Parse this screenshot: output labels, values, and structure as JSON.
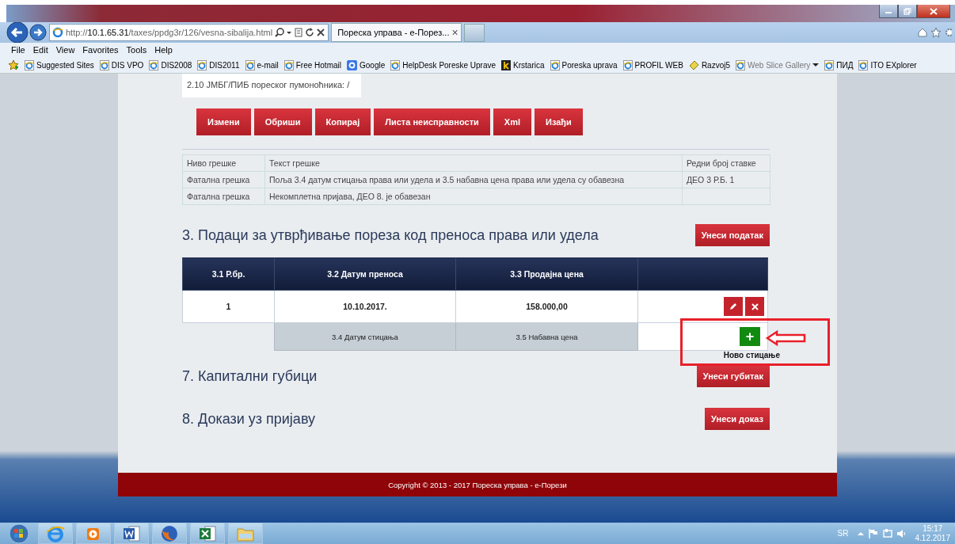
{
  "browser": {
    "address": "http://**10.1.65.31**/taxes/ppdg3r/126/vesna-sibalija.html",
    "tab": {
      "title": "Пореска управа - е-Порез...",
      "close": "×"
    },
    "menu": [
      "File",
      "Edit",
      "View",
      "Favorites",
      "Tools",
      "Help"
    ],
    "favorites": [
      {
        "label": "Suggested Sites",
        "kind": "ie"
      },
      {
        "label": "DIS VPO",
        "kind": "ie"
      },
      {
        "label": "DIS2008",
        "kind": "ie"
      },
      {
        "label": "DIS2011",
        "kind": "ie"
      },
      {
        "label": "e-mail",
        "kind": "ie"
      },
      {
        "label": "Free Hotmail",
        "kind": "ie"
      },
      {
        "label": "Google",
        "kind": "google"
      },
      {
        "label": "HelpDesk Poreske Uprave",
        "kind": "ie"
      },
      {
        "label": "Krstarica",
        "kind": "k"
      },
      {
        "label": "Poreska uprava",
        "kind": "ie"
      },
      {
        "label": "PROFIL WEB",
        "kind": "ie"
      },
      {
        "label": "Razvoj5",
        "kind": "slice"
      },
      {
        "label": "Web Slice Gallery",
        "kind": "gallery"
      },
      {
        "label": "ПИД",
        "kind": "ie"
      },
      {
        "label": "ITO EXplorer",
        "kind": "ie"
      }
    ]
  },
  "page": {
    "info_text": "2.10 ЈМБГ/ПИБ пореског пумоноћника: /",
    "action_buttons": [
      "Измени",
      "Обриши",
      "Копирај",
      "Листа неисправности",
      "Xml",
      "Изађи"
    ],
    "errors": {
      "columns": [
        "Ниво грешке",
        "Текст грешке",
        "Редни број ставке"
      ],
      "rows": [
        [
          "Фатална грешка",
          "Поља 3.4 датум стицања права или удела и 3.5 набавна цена права или удела су обавезна",
          "ДЕО 3 Р.Б. 1"
        ],
        [
          "Фатална грешка",
          "Некомплетна пријава, ДЕО 8. је обавезан",
          ""
        ]
      ]
    },
    "section3": {
      "heading": "3. Подаци за утврђивање пореза код преноса права или удела",
      "button": "Унеси податак",
      "columns": [
        "3.1 Р.бр.",
        "3.2 Датум преноса",
        "3.3 Продајна цена"
      ],
      "rows": [
        [
          "1",
          "10.10.2017.",
          "158.000,00"
        ]
      ],
      "sub_columns": [
        "3.4 Датум стицања",
        "3.5 Набавна цена"
      ],
      "add_button": "+",
      "add_label": "Ново стицање"
    },
    "section7": {
      "heading": "7. Капитални губици",
      "button": "Унеси губитак"
    },
    "section8": {
      "heading": "8. Докази уз пријаву",
      "button": "Унеси доказ"
    },
    "footer": "Copyright © 2013 - 2017 Пореска управа - е-Порези"
  },
  "taskbar": {
    "apps": [
      {
        "kind": "ie"
      },
      {
        "kind": "media"
      },
      {
        "kind": "word"
      },
      {
        "kind": "firefox"
      },
      {
        "kind": "excel"
      },
      {
        "kind": "folder"
      }
    ],
    "language": "SR",
    "time": "15:17",
    "date": "4.12.2017"
  }
}
